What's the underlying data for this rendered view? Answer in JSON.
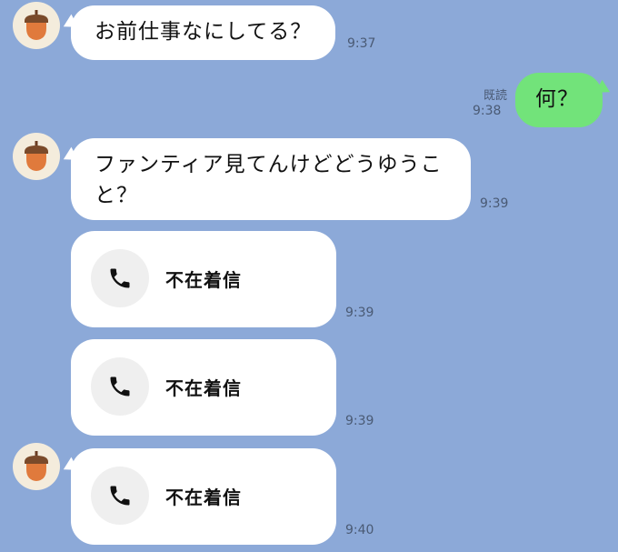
{
  "messages": [
    {
      "type": "text",
      "side": "incoming",
      "text": "お前仕事なにしてる？",
      "time": "9:37"
    },
    {
      "type": "text",
      "side": "outgoing",
      "text": "何？",
      "time": "9:38",
      "read": "既読"
    },
    {
      "type": "text",
      "side": "incoming",
      "text": "ファンティア見てんけどどうゆうこと？",
      "time": "9:39"
    },
    {
      "type": "call",
      "side": "incoming",
      "label": "不在着信",
      "time": "9:39"
    },
    {
      "type": "call",
      "side": "incoming",
      "label": "不在着信",
      "time": "9:39"
    },
    {
      "type": "call",
      "side": "incoming",
      "label": "不在着信",
      "time": "9:40"
    }
  ],
  "colors": {
    "background": "#8ca9d8",
    "incoming_bubble": "#ffffff",
    "outgoing_bubble": "#72e37a",
    "avatar_bg": "#f4ecdc",
    "acorn_cap": "#7a4a2a",
    "acorn_body": "#e07a3c"
  },
  "icons": {
    "avatar": "acorn-icon",
    "call": "phone-icon"
  }
}
